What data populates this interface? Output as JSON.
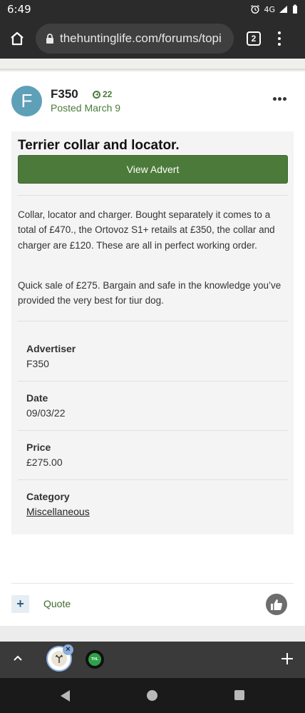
{
  "status_bar": {
    "time": "6:49",
    "network": "4G"
  },
  "browser": {
    "url": "thehuntinglife.com/forums/topi",
    "tab_count": "2"
  },
  "post": {
    "avatar_letter": "F",
    "author": "F350",
    "reputation": "22",
    "posted": "Posted March 9"
  },
  "advert": {
    "title": "Terrier collar and locator.",
    "button_label": "View Advert",
    "paragraphs": [
      "Collar, locator and charger. Bought separately it comes to a total of £470., the Ortovoz S1+ retails at £350, the collar and charger are £120. These are all in perfect working order.",
      "Quick sale of £275. Bargain and safe in the knowledge you’ve provided the very best for tiur dog."
    ],
    "fields": [
      {
        "label": "Advertiser",
        "value": "F350"
      },
      {
        "label": "Date",
        "value": "09/03/22"
      },
      {
        "label": "Price",
        "value": "£275.00"
      },
      {
        "label": "Category",
        "value": "Miscellaneous"
      }
    ]
  },
  "actions": {
    "plus": "+",
    "quote": "Quote"
  },
  "tab_strip": {
    "tab_close": "×",
    "tab2_label": "THL"
  },
  "colors": {
    "accent_green": "#4c7a3a",
    "avatar_blue": "#5fa0b9",
    "tab_highlight": "#89aee0"
  }
}
